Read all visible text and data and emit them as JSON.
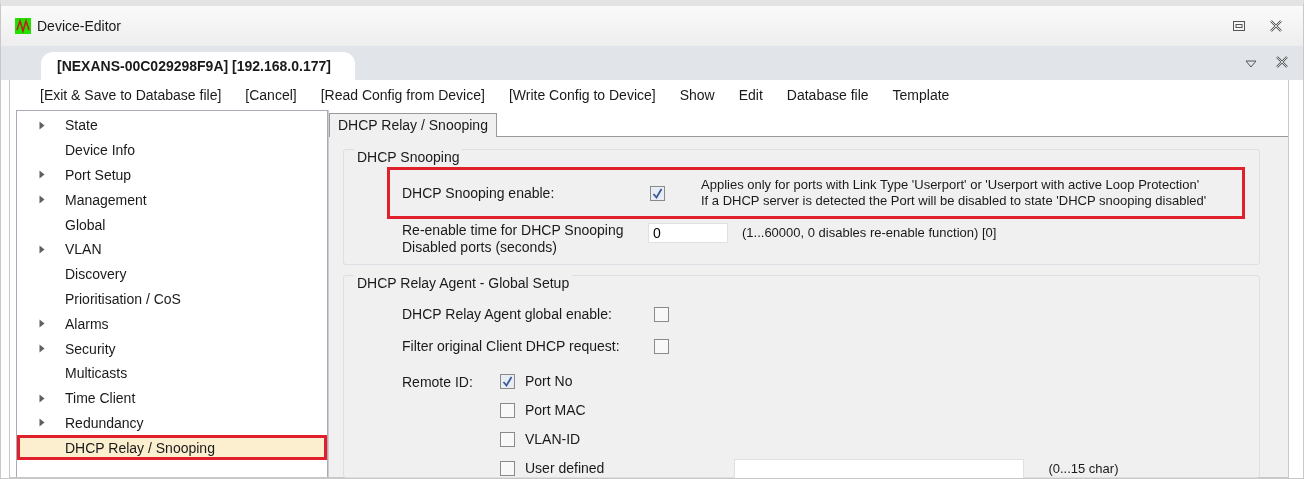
{
  "window": {
    "title": "Device-Editor"
  },
  "document_tab": {
    "label": "[NEXANS-00C029298F9A] [192.168.0.177]",
    "selected": true
  },
  "toolbar": [
    "[Exit & Save to Database file]",
    "[Cancel]",
    "[Read Config from Device]",
    "[Write Config to Device]",
    "Show",
    "Edit",
    "Database file",
    "Template"
  ],
  "sidebar": {
    "items": [
      {
        "label": "State",
        "expandable": true,
        "selected": false
      },
      {
        "label": "Device Info",
        "expandable": false,
        "selected": false
      },
      {
        "label": "Port Setup",
        "expandable": true,
        "selected": false
      },
      {
        "label": "Management",
        "expandable": true,
        "selected": false
      },
      {
        "label": "Global",
        "expandable": false,
        "selected": false
      },
      {
        "label": "VLAN",
        "expandable": true,
        "selected": false
      },
      {
        "label": "Discovery",
        "expandable": false,
        "selected": false
      },
      {
        "label": "Prioritisation / CoS",
        "expandable": false,
        "selected": false
      },
      {
        "label": "Alarms",
        "expandable": true,
        "selected": false
      },
      {
        "label": "Security",
        "expandable": true,
        "selected": false
      },
      {
        "label": "Multicasts",
        "expandable": false,
        "selected": false
      },
      {
        "label": "Time Client",
        "expandable": true,
        "selected": false
      },
      {
        "label": "Redundancy",
        "expandable": true,
        "selected": false
      },
      {
        "label": "DHCP Relay / Snooping",
        "expandable": false,
        "selected": true
      }
    ]
  },
  "content_tab": {
    "label": "DHCP Relay / Snooping",
    "selected": true
  },
  "snooping": {
    "title": "DHCP Snooping",
    "enable": {
      "label": "DHCP Snooping enable:",
      "checked": true,
      "highlighted": true,
      "note": [
        "Applies only for ports with Link Type 'Userport' or 'Userport with active Loop Protection'",
        "If a DHCP server is detected the Port will be disabled to state 'DHCP snooping disabled'"
      ]
    },
    "reenable": {
      "label": "Re-enable time for DHCP Snooping Disabled ports (seconds)",
      "value": "0",
      "hint": "(1...60000, 0 disables re-enable function) [0]"
    }
  },
  "relay": {
    "title": "DHCP Relay Agent - Global Setup",
    "options": [
      {
        "label": "DHCP Relay Agent global enable:",
        "checked": false
      },
      {
        "label": "Filter original Client DHCP request:",
        "checked": false
      }
    ],
    "remote_id": {
      "label": "Remote ID:",
      "choices": [
        {
          "label": "Port No",
          "checked": true
        },
        {
          "label": "Port MAC",
          "checked": false
        },
        {
          "label": "VLAN-ID",
          "checked": false
        },
        {
          "label": "User defined",
          "checked": false
        }
      ],
      "hint": "(0...15 char)"
    }
  }
}
